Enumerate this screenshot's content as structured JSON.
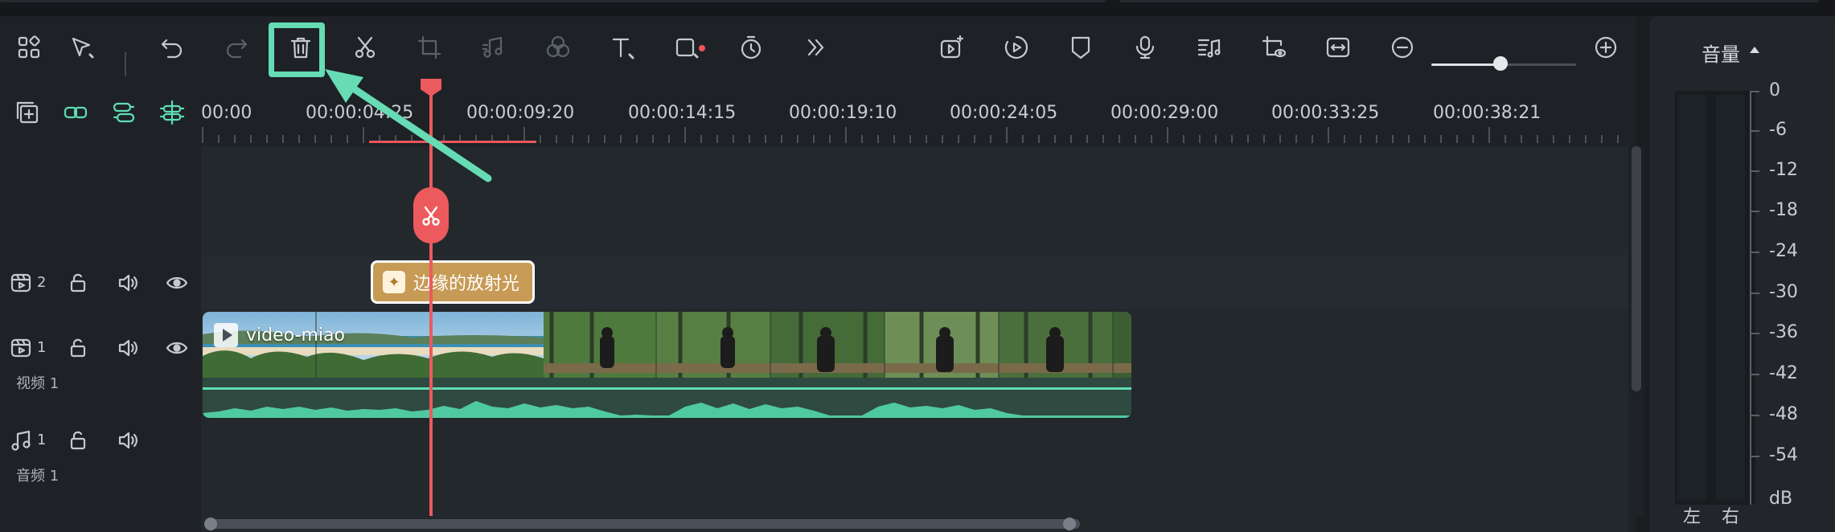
{
  "toolbar": {
    "tools": [
      "layout-icon",
      "select-tool-icon",
      "undo-icon",
      "redo-icon",
      "delete-icon",
      "split-icon",
      "crop-icon",
      "audio-adjust-icon",
      "color-icon",
      "text-icon",
      "shape-icon",
      "speed-icon",
      "more-icon"
    ],
    "right_tools": [
      "ai-video-icon",
      "auto-reframe-icon",
      "marker-icon",
      "record-voice-icon",
      "audio-beat-icon",
      "preview-render-icon",
      "fit-timeline-icon",
      "zoom-out-icon",
      "zoom-in-icon"
    ],
    "zoom_level": 0.49
  },
  "timeline": {
    "timecodes": [
      "00:00",
      "00:00:04:25",
      "00:00:09:20",
      "00:00:14:15",
      "00:00:19:10",
      "00:00:24:05",
      "00:00:29:00",
      "00:00:33:25",
      "00:00:38:21"
    ],
    "tracks": {
      "effect_track_number": "2",
      "video_track_number": "1",
      "video_track_label": "视频 1",
      "audio_track_number": "1",
      "audio_track_label": "音频 1"
    },
    "effect_clip_label": "边缘的放射光",
    "video_clip_name": "video-miao"
  },
  "meter": {
    "title": "音量",
    "db_labels": [
      "0",
      "-6",
      "-12",
      "-18",
      "-24",
      "-30",
      "-36",
      "-42",
      "-48",
      "-54",
      "dB"
    ],
    "left_label": "左",
    "right_label": "右"
  },
  "colors": {
    "accent": "#66dbb4",
    "playhead": "#ec5a5e",
    "effect_clip": "#c79a55"
  }
}
